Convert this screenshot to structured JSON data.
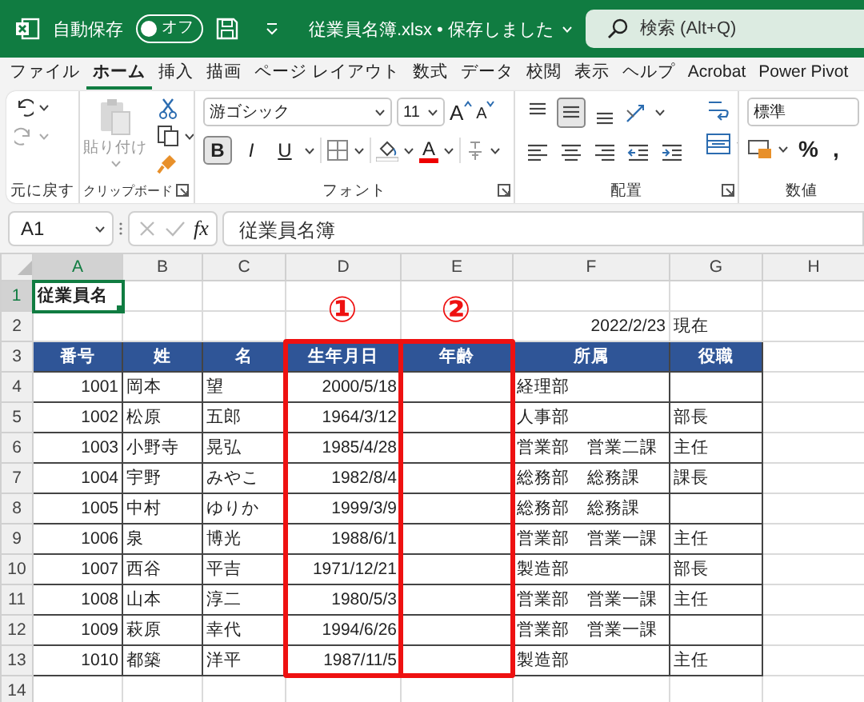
{
  "title_bar": {
    "autosave_label": "自動保存",
    "autosave_toggle": {
      "label": "オフ",
      "on": false
    },
    "title": "従業員名簿.xlsx • 保存しました",
    "search_placeholder": "検索 (Alt+Q)"
  },
  "menu_tabs": [
    {
      "label": "ファイル",
      "selected": false
    },
    {
      "label": "ホーム",
      "selected": true
    },
    {
      "label": "挿入",
      "selected": false
    },
    {
      "label": "描画",
      "selected": false
    },
    {
      "label": "ページ レイアウト",
      "selected": false
    },
    {
      "label": "数式",
      "selected": false
    },
    {
      "label": "データ",
      "selected": false
    },
    {
      "label": "校閲",
      "selected": false
    },
    {
      "label": "表示",
      "selected": false
    },
    {
      "label": "ヘルプ",
      "selected": false
    },
    {
      "label": "Acrobat",
      "selected": false
    },
    {
      "label": "Power Pivot",
      "selected": false
    }
  ],
  "ribbon": {
    "groups": [
      {
        "kind": "undo",
        "label": "元に戻す"
      },
      {
        "kind": "clipboard",
        "label": "クリップボード",
        "paste_label": "貼り付け"
      },
      {
        "kind": "font",
        "label": "フォント",
        "font_name": "游ゴシック",
        "font_size": "11",
        "size_buttons": [
          "A",
          "A"
        ],
        "style_buttons": [
          {
            "label": "B",
            "selected": true
          },
          {
            "label": "I",
            "selected": false
          },
          {
            "label": "U",
            "selected": false
          }
        ],
        "font_color_label": "A"
      },
      {
        "kind": "alignment",
        "label": "配置",
        "vertical_buttons": [
          {
            "selected": false
          },
          {
            "selected": true
          },
          {
            "selected": false
          }
        ]
      },
      {
        "kind": "number",
        "label": "数値",
        "format": "標準",
        "symbols": [
          "%",
          ","
        ]
      }
    ]
  },
  "formula_bar": {
    "name_box": "A1",
    "function_label": "fx",
    "formula": "従業員名簿"
  },
  "sheet": {
    "columns": [
      {
        "letter": "A",
        "selected": true
      },
      {
        "letter": "B",
        "selected": false
      },
      {
        "letter": "C",
        "selected": false
      },
      {
        "letter": "D",
        "selected": false,
        "callout": "①"
      },
      {
        "letter": "E",
        "selected": false,
        "callout": "②"
      },
      {
        "letter": "F",
        "selected": false
      },
      {
        "letter": "G",
        "selected": false
      },
      {
        "letter": "H",
        "selected": false
      }
    ],
    "rows": [
      {
        "number": "1",
        "kind": "title",
        "selected": true,
        "cells": {
          "A": "従業員名"
        }
      },
      {
        "number": "2",
        "kind": "note",
        "selected": false,
        "cells": {
          "F": "2022/2/23",
          "G": "現在"
        }
      },
      {
        "number": "3",
        "kind": "header",
        "selected": false,
        "cells": {
          "A": "番号",
          "B": "姓",
          "C": "名",
          "D": "生年月日",
          "E": "年齢",
          "F": "所属",
          "G": "役職"
        }
      },
      {
        "number": "4",
        "kind": "data",
        "selected": false,
        "cells": {
          "A": "1001",
          "B": "岡本",
          "C": "望",
          "D": "2000/5/18",
          "F": "経理部"
        }
      },
      {
        "number": "5",
        "kind": "data",
        "selected": false,
        "cells": {
          "A": "1002",
          "B": "松原",
          "C": "五郎",
          "D": "1964/3/12",
          "F": "人事部",
          "G": "部長"
        }
      },
      {
        "number": "6",
        "kind": "data",
        "selected": false,
        "cells": {
          "A": "1003",
          "B": "小野寺",
          "C": "晃弘",
          "D": "1985/4/28",
          "F": "営業部　営業二課",
          "G": "主任"
        }
      },
      {
        "number": "7",
        "kind": "data",
        "selected": false,
        "cells": {
          "A": "1004",
          "B": "宇野",
          "C": "みやこ",
          "D": "1982/8/4",
          "F": "総務部　総務課",
          "G": "課長"
        }
      },
      {
        "number": "8",
        "kind": "data",
        "selected": false,
        "cells": {
          "A": "1005",
          "B": "中村",
          "C": "ゆりか",
          "D": "1999/3/9",
          "F": "総務部　総務課"
        }
      },
      {
        "number": "9",
        "kind": "data",
        "selected": false,
        "cells": {
          "A": "1006",
          "B": "泉",
          "C": "博光",
          "D": "1988/6/1",
          "F": "営業部　営業一課",
          "G": "主任"
        }
      },
      {
        "number": "10",
        "kind": "data",
        "selected": false,
        "cells": {
          "A": "1007",
          "B": "西谷",
          "C": "平吉",
          "D": "1971/12/21",
          "F": "製造部",
          "G": "部長"
        }
      },
      {
        "number": "11",
        "kind": "data",
        "selected": false,
        "cells": {
          "A": "1008",
          "B": "山本",
          "C": "淳二",
          "D": "1980/5/3",
          "F": "営業部　営業一課",
          "G": "主任"
        }
      },
      {
        "number": "12",
        "kind": "data",
        "selected": false,
        "cells": {
          "A": "1009",
          "B": "萩原",
          "C": "幸代",
          "D": "1994/6/26",
          "F": "営業部　営業一課"
        }
      },
      {
        "number": "13",
        "kind": "data",
        "selected": false,
        "cells": {
          "A": "1010",
          "B": "都築",
          "C": "洋平",
          "D": "1987/11/5",
          "F": "製造部",
          "G": "主任"
        }
      },
      {
        "number": "14",
        "kind": "blank",
        "selected": false,
        "cells": {}
      }
    ]
  }
}
